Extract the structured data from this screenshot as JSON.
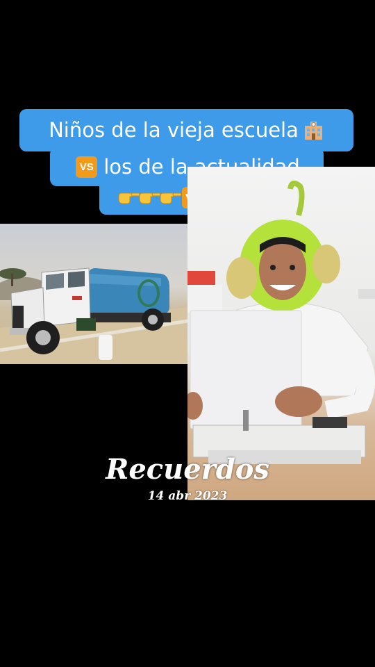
{
  "caption": {
    "line1": "Niños de la vieja escuela",
    "line2": "los de la actualidad",
    "vs_label": "VS",
    "badge_color": "#f29a1c",
    "bubble_color": "#3d9be9"
  },
  "overlay": {
    "title": "Recuerdos",
    "date": "14 abr 2023"
  }
}
